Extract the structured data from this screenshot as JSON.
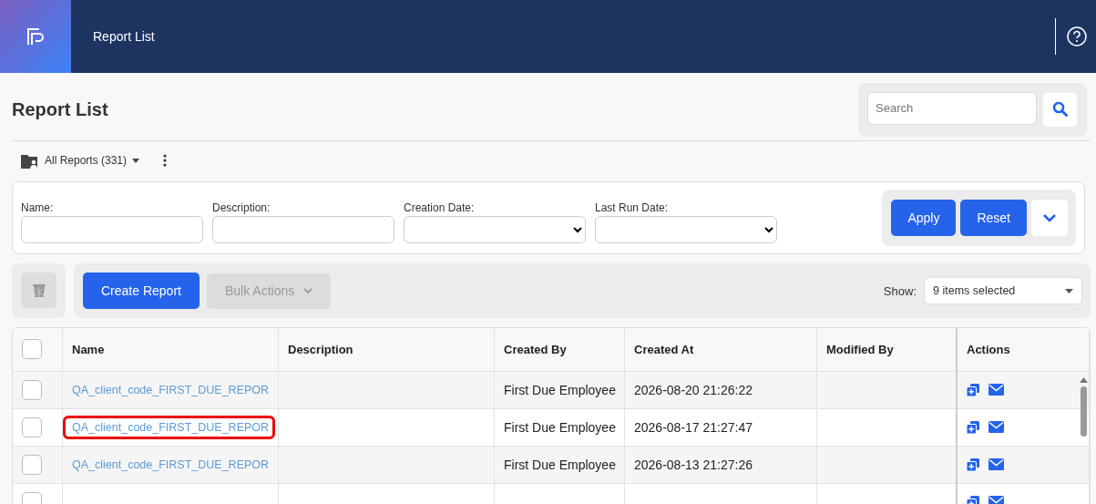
{
  "header": {
    "title": "Report List"
  },
  "page": {
    "title": "Report List",
    "search": {
      "placeholder": "Search"
    }
  },
  "folder": {
    "label": "All Reports (331)"
  },
  "filters": [
    {
      "label": "Name:",
      "kind": "text"
    },
    {
      "label": "Description:",
      "kind": "text"
    },
    {
      "label": "Creation Date:",
      "kind": "select"
    },
    {
      "label": "Last Run Date:",
      "kind": "select"
    }
  ],
  "filter_buttons": [
    "Apply",
    "Reset"
  ],
  "toolbar": {
    "create": "Create Report",
    "bulk": {
      "label": "Bulk Actions",
      "disabled": true
    },
    "show_label": "Show:",
    "show_value": "9 items selected"
  },
  "table": {
    "all_checked": false,
    "columns": [
      "Name",
      "Description",
      "Created By",
      "Created At",
      "Modified By",
      "Actions"
    ],
    "rows": [
      {
        "checked": false,
        "highlighted": false,
        "cells": [
          "QA_client_code_FIRST_DUE_REPOR",
          "",
          "First Due Employee",
          "2026-08-20 21:26:22",
          ""
        ]
      },
      {
        "checked": false,
        "highlighted": true,
        "cells": [
          "QA_client_code_FIRST_DUE_REPOR",
          "",
          "First Due Employee",
          "2026-08-17 21:27:47",
          ""
        ]
      },
      {
        "checked": false,
        "highlighted": false,
        "cells": [
          "QA_client_code_FIRST_DUE_REPOR",
          "",
          "First Due Employee",
          "2026-08-13 21:27:26",
          ""
        ]
      },
      {
        "checked": false,
        "cells": []
      }
    ]
  }
}
